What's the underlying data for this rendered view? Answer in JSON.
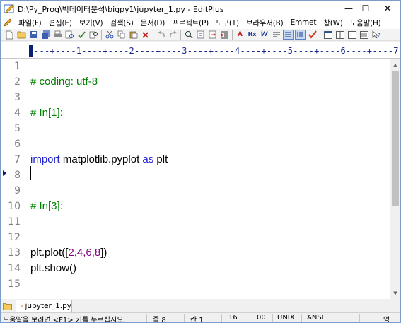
{
  "window": {
    "title": "D:\\Py_Prog\\빅데이터분석\\bigpy1\\jupyter_1.py - EditPlus",
    "minimize_glyph": "—",
    "maximize_glyph": "☐",
    "close_glyph": "✕"
  },
  "menu": [
    {
      "label": "파일(F)"
    },
    {
      "label": "편집(E)"
    },
    {
      "label": "보기(V)"
    },
    {
      "label": "검색(S)"
    },
    {
      "label": "문서(D)"
    },
    {
      "label": "프로젝트(P)"
    },
    {
      "label": "도구(T)"
    },
    {
      "label": "브라우저(B)"
    },
    {
      "label": "Emmet"
    },
    {
      "label": "창(W)"
    },
    {
      "label": "도움말(H)"
    }
  ],
  "toolbar": {
    "icons": [
      "new-file",
      "open-file",
      "save-file",
      "save-all",
      "print",
      "print-preview",
      "spell-check",
      "find-in-files",
      "cut",
      "copy",
      "paste",
      "delete",
      "undo",
      "redo",
      "find",
      "replace",
      "goto-line",
      "indent",
      "font-size",
      "hex",
      "word-wrap",
      "cliptext",
      "tab",
      "check",
      "window-split",
      "window-tile",
      "window-cascade",
      "window-list",
      "help"
    ]
  },
  "ruler": {
    "text": "---+----1----+----2----+----3----+----4----+----5----+----6----+----7"
  },
  "editor": {
    "line_numbers": [
      "1",
      "2",
      "3",
      "4",
      "5",
      "6",
      "7",
      "8",
      "9",
      "10",
      "11",
      "12",
      "13",
      "14",
      "15"
    ],
    "current_line": 8,
    "lines": {
      "l2": "# coding: utf-8",
      "l4": "# In[1]:",
      "l7_kw1": "import",
      "l7_mid": " matplotlib.pyplot ",
      "l7_kw2": "as",
      "l7_end": " plt",
      "l10": "# In[3]:",
      "l13_a": "plt.plot([",
      "l13_n": "2,4,6,8",
      "l13_b": "])",
      "l14": "plt.show()"
    }
  },
  "tabs": [
    {
      "label": "jupyter_1.py"
    }
  ],
  "status": {
    "hint": "도움말을 보려면 <F1> 키를 누르십시오.",
    "line": "줄 8",
    "column": "칸 1",
    "count": "16",
    "flag": "00",
    "line_ending": "UNIX",
    "encoding": "ANSI",
    "ime": "영"
  },
  "colors": {
    "comment": "#008000",
    "keyword": "#2020d0",
    "number": "#800080",
    "ruler": "#1a2a8a",
    "line_number": "#808080"
  }
}
